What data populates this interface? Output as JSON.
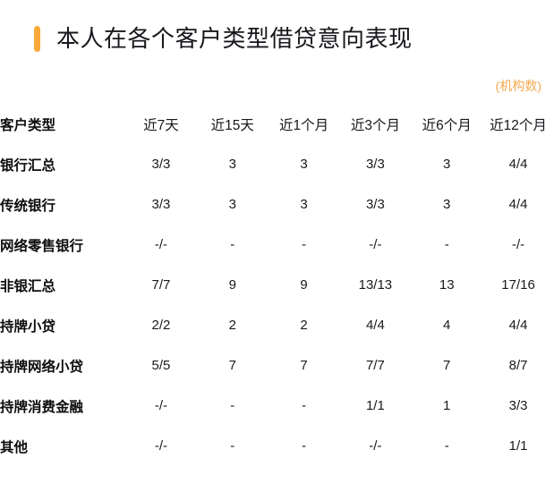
{
  "header": {
    "title": "本人在各个客户类型借贷意向表现",
    "accent_color": "#f9a938",
    "unit_note": "(机构数)",
    "unit_note_color": "#f5a94e"
  },
  "chart_data": {
    "type": "table",
    "title": "本人在各个客户类型借贷意向表现",
    "unit": "(机构数)",
    "row_header_label": "客户类型",
    "categories": [
      "近7天",
      "近15天",
      "近1个月",
      "近3个月",
      "近6个月",
      "近12个月"
    ],
    "rows": [
      {
        "label": "银行汇总",
        "values": [
          "3/3",
          "3",
          "3",
          "3/3",
          "3",
          "4/4"
        ]
      },
      {
        "label": "传统银行",
        "values": [
          "3/3",
          "3",
          "3",
          "3/3",
          "3",
          "4/4"
        ]
      },
      {
        "label": "网络零售银行",
        "values": [
          "-/-",
          "-",
          "-",
          "-/-",
          "-",
          "-/-"
        ]
      },
      {
        "label": "非银汇总",
        "values": [
          "7/7",
          "9",
          "9",
          "13/13",
          "13",
          "17/16"
        ]
      },
      {
        "label": "持牌小贷",
        "values": [
          "2/2",
          "2",
          "2",
          "4/4",
          "4",
          "4/4"
        ]
      },
      {
        "label": "持牌网络小贷",
        "values": [
          "5/5",
          "7",
          "7",
          "7/7",
          "7",
          "8/7"
        ]
      },
      {
        "label": "持牌消费金融",
        "values": [
          "-/-",
          "-",
          "-",
          "1/1",
          "1",
          "3/3"
        ]
      },
      {
        "label": "其他",
        "values": [
          "-/-",
          "-",
          "-",
          "-/-",
          "-",
          "1/1"
        ]
      }
    ]
  }
}
